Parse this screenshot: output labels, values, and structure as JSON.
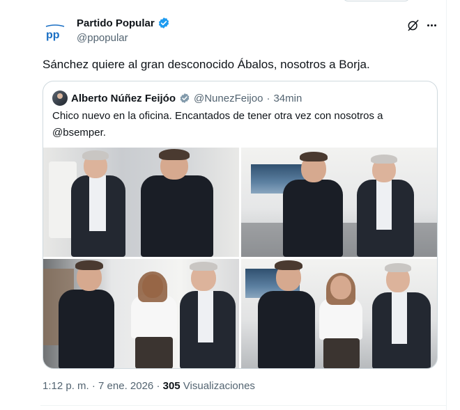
{
  "tweet": {
    "author_name": "Partido Popular",
    "author_handle": "@ppopular",
    "avatar_text": "pp",
    "text": "Sánchez quiere al gran desconocido Ábalos, nosotros a Borja.",
    "timestamp": "1:12 p. m. · 7 ene. 2026 · ",
    "views_count": "305",
    "views_label": " Visualizaciones"
  },
  "quote": {
    "author_name": "Alberto Núñez Feijóo",
    "author_handle": "@NunezFeijoo",
    "separator": "·",
    "time": "34min",
    "text": "Chico nuevo en la oficina. Encantados de tener otra vez con nosotros a @bsemper."
  },
  "icons": {
    "verified": "verified-badge-icon",
    "grok": "grok-icon",
    "more": "more-options-icon"
  },
  "colors": {
    "text_primary": "#0f1419",
    "text_secondary": "#536471",
    "verified_blue": "#1d9bf0",
    "verified_gray": "#829aab",
    "border": "#cfd9de",
    "pp_blue": "#1a6fc4"
  }
}
